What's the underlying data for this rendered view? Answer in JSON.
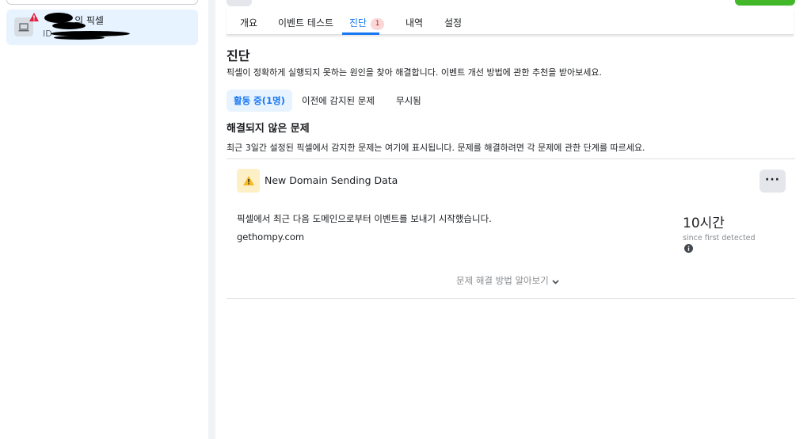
{
  "sidebar": {
    "pixel": {
      "name": "의 픽셀",
      "id_prefix": "ID"
    }
  },
  "tabs": [
    {
      "label": "개요"
    },
    {
      "label": "이벤트 테스트"
    },
    {
      "label": "진단",
      "badge": "1"
    },
    {
      "label": "내역"
    },
    {
      "label": "설정"
    }
  ],
  "diagnostics": {
    "title": "진단",
    "description": "픽셀이 정확하게 실행되지 못하는 원인을 찾아 해결합니다. 이벤트 개선 방법에 관한 추천을 받아보세요.",
    "subtabs": [
      {
        "label": "활동 중(1명)"
      },
      {
        "label": "이전에 감지된 문제"
      },
      {
        "label": "무시됨"
      }
    ],
    "unresolved_title": "해결되지 않은 문제",
    "unresolved_description": "최근 3일간 설정된 픽셀에서 감지한 문제는 여기에 표시됩니다. 문제를 해결하려면 각 문제에 관한 단계를 따르세요.",
    "issue": {
      "title": "New Domain Sending Data",
      "more_label": "···",
      "description": "픽셀에서 최근 다음 도메인으로부터 이벤트를 보내기 시작했습니다.",
      "domain": "gethompy.com",
      "metric_value": "10시간",
      "metric_label": "since first detected"
    },
    "learn_more": "문제 해결 방법 알아보기"
  },
  "colors": {
    "accent": "#1877f2",
    "warning": "#f7b928",
    "badge_bg": "#fbd7d7",
    "badge_text": "#c0262d",
    "green": "#42b72a"
  }
}
